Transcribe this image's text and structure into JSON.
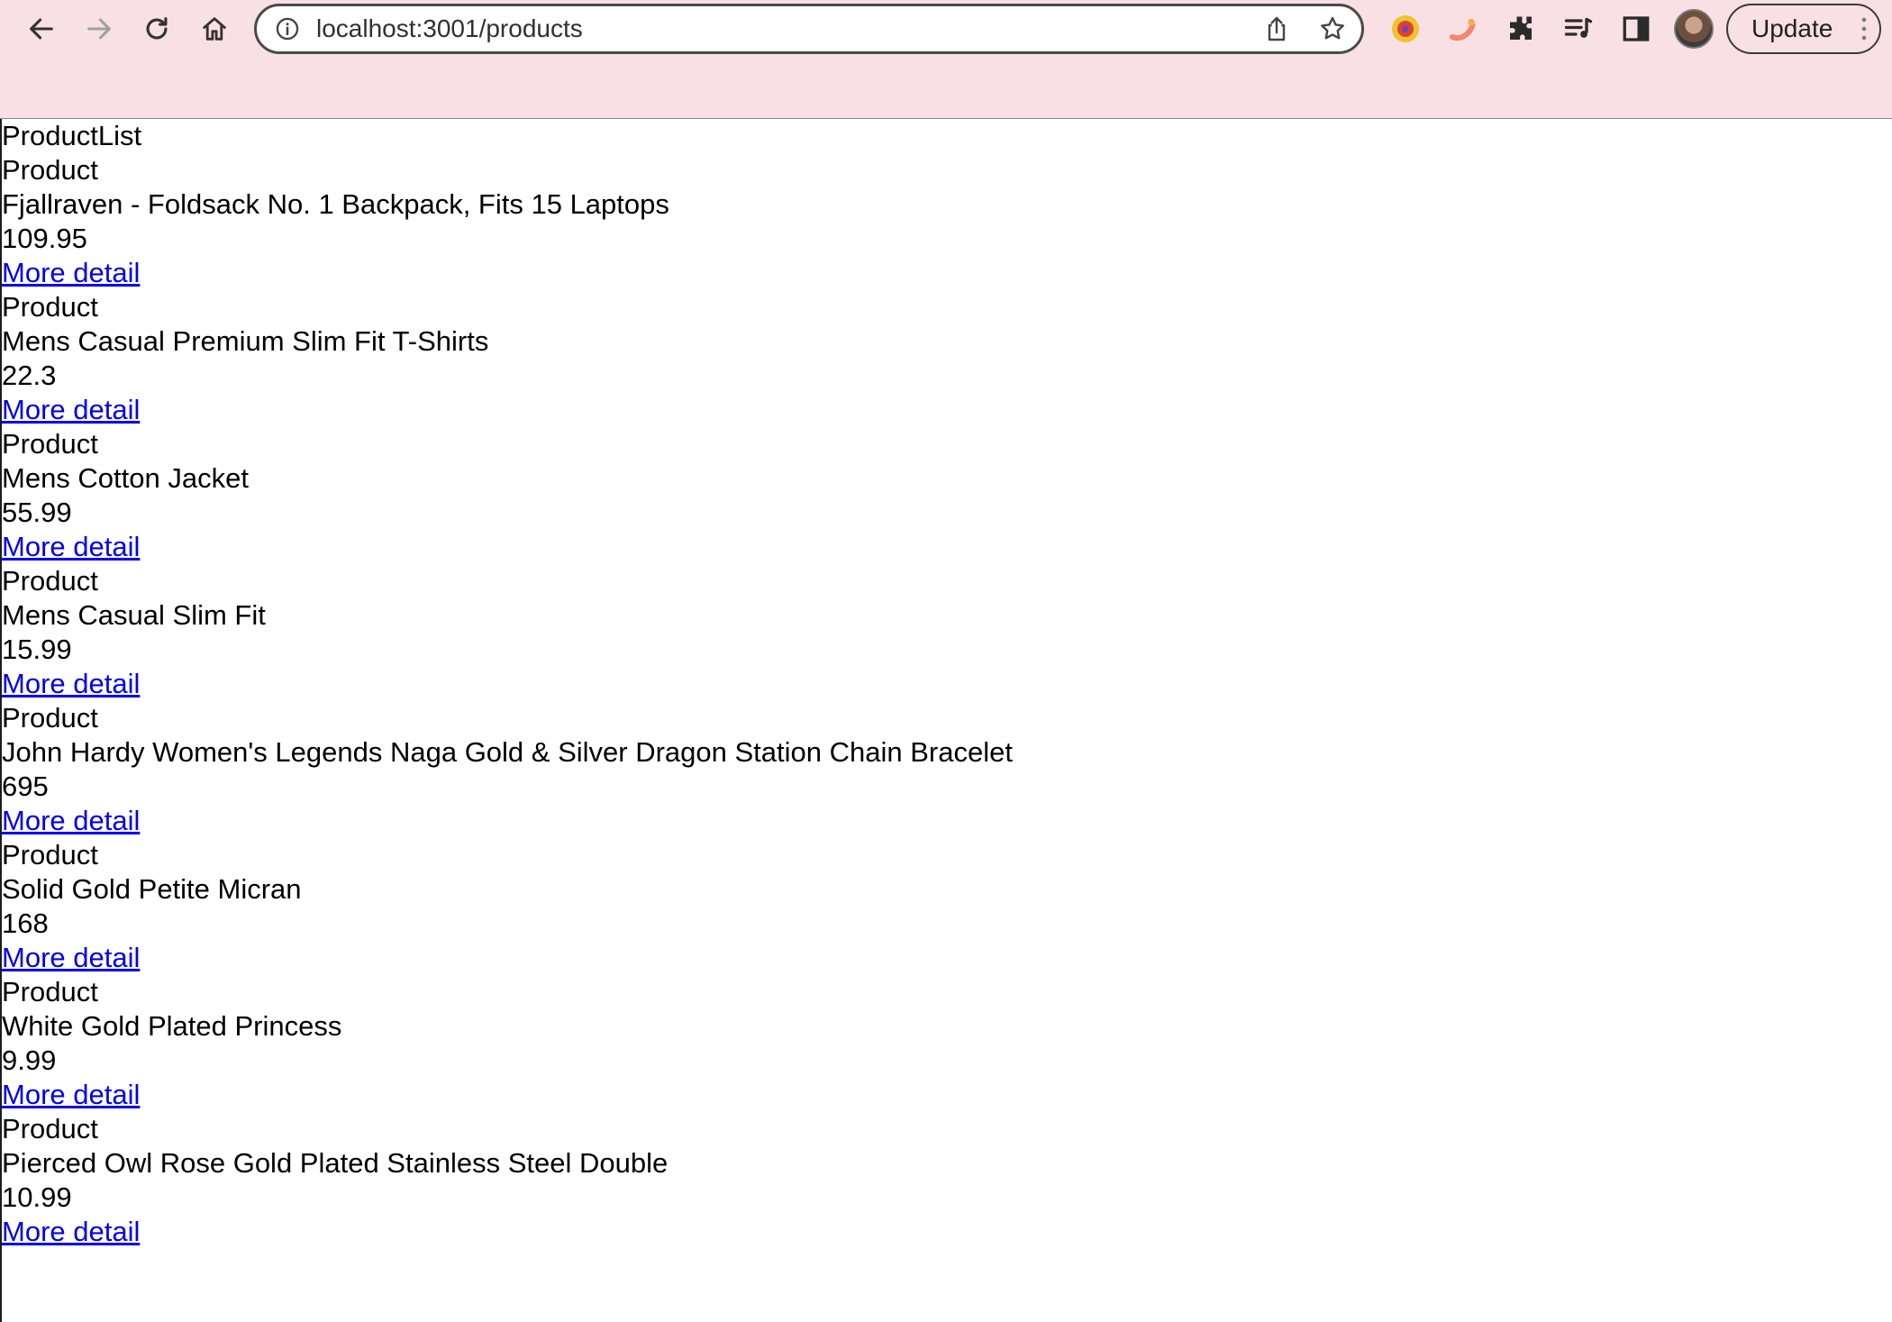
{
  "browser": {
    "url": "localhost:3001/products",
    "update_label": "Update",
    "toolbar_color": "#f9e0e5"
  },
  "page": {
    "heading": "ProductList",
    "link_color": "#0000ee",
    "products": [
      {
        "label": "Product",
        "title": "Fjallraven - Foldsack No. 1 Backpack, Fits 15 Laptops",
        "price": "109.95",
        "link": "More detail"
      },
      {
        "label": "Product",
        "title": "Mens Casual Premium Slim Fit T-Shirts",
        "price": "22.3",
        "link": "More detail"
      },
      {
        "label": "Product",
        "title": "Mens Cotton Jacket",
        "price": "55.99",
        "link": "More detail"
      },
      {
        "label": "Product",
        "title": "Mens Casual Slim Fit",
        "price": "15.99",
        "link": "More detail"
      },
      {
        "label": "Product",
        "title": "John Hardy Women's Legends Naga Gold & Silver Dragon Station Chain Bracelet",
        "price": "695",
        "link": "More detail"
      },
      {
        "label": "Product",
        "title": "Solid Gold Petite Micran",
        "price": "168",
        "link": "More detail"
      },
      {
        "label": "Product",
        "title": "White Gold Plated Princess",
        "price": "9.99",
        "link": "More detail"
      },
      {
        "label": "Product",
        "title": "Pierced Owl Rose Gold Plated Stainless Steel Double",
        "price": "10.99",
        "link": "More detail"
      }
    ]
  }
}
